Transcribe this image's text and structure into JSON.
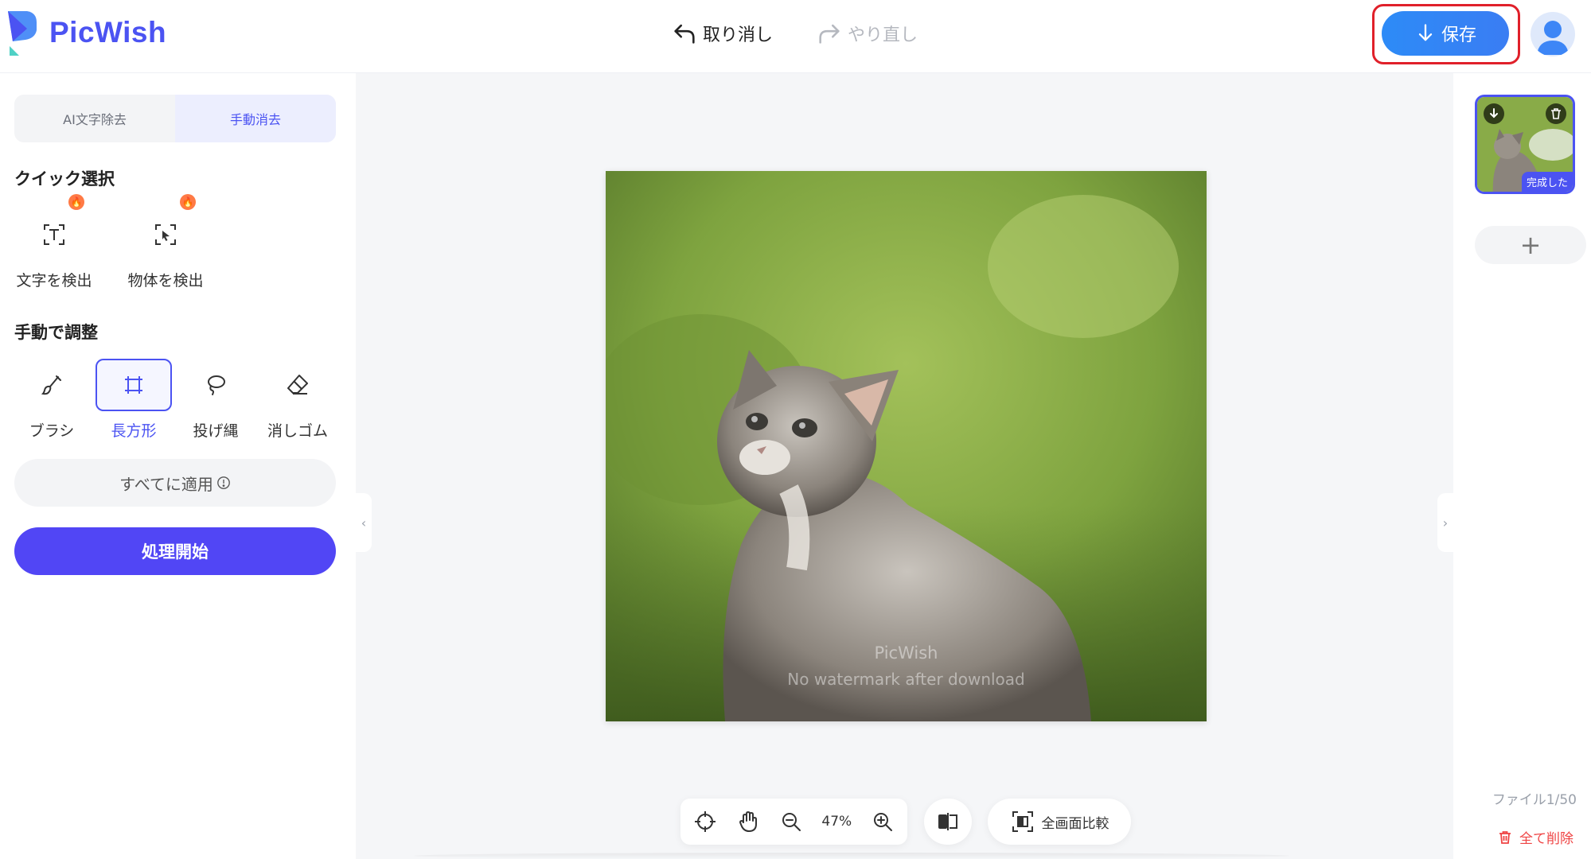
{
  "brand": {
    "name": "PicWish",
    "color": "#4b53f2"
  },
  "header": {
    "undo_label": "取り消し",
    "redo_label": "やり直し",
    "save_label": "保存"
  },
  "sidebar": {
    "tabs": [
      {
        "label": "AI文字除去",
        "active": false
      },
      {
        "label": "手動消去",
        "active": true
      }
    ],
    "quick_select_title": "クイック選択",
    "quick_tools": [
      {
        "label": "文字を検出",
        "icon": "text-detect-icon",
        "hot": true
      },
      {
        "label": "物体を検出",
        "icon": "object-detect-icon",
        "hot": true
      }
    ],
    "manual_title": "手動で調整",
    "manual_tools": [
      {
        "label": "ブラシ",
        "icon": "brush-icon",
        "active": false
      },
      {
        "label": "長方形",
        "icon": "rectangle-icon",
        "active": true
      },
      {
        "label": "投げ縄",
        "icon": "lasso-icon",
        "active": false
      },
      {
        "label": "消しゴム",
        "icon": "eraser-icon",
        "active": false
      }
    ],
    "apply_all_label": "すべてに適用",
    "process_label": "処理開始"
  },
  "canvas": {
    "watermark_line1": "PicWish",
    "watermark_line2": "No watermark after download"
  },
  "toolbar": {
    "zoom_value": "47%",
    "full_compare_label": "全画面比較"
  },
  "rightbar": {
    "thumb_badge": "完成した",
    "file_count": "ファイル1/50",
    "delete_all_label": "全て削除"
  },
  "colors": {
    "accent": "#4b53f2",
    "save_button": "#2d8bf7",
    "process_button": "#5146f5",
    "highlight_outline": "#e0202a",
    "danger": "#ef4444"
  }
}
